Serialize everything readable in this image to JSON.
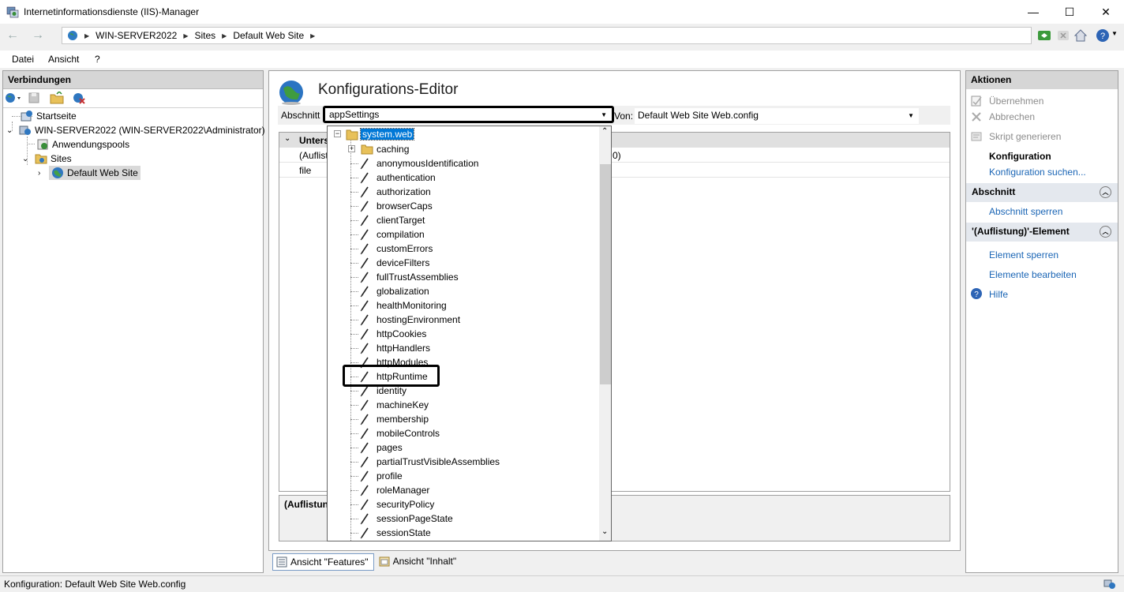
{
  "window": {
    "title": "Internetinformationsdienste (IIS)-Manager",
    "app_icon": "iis-manager-icon",
    "minimize": "—",
    "maximize": "☐",
    "close": "✕"
  },
  "address": {
    "crumbs": [
      "WIN-SERVER2022",
      "Sites",
      "Default Web Site"
    ]
  },
  "menu": [
    "Datei",
    "Ansicht",
    "?"
  ],
  "connections": {
    "header": "Verbindungen",
    "tree": [
      {
        "label": "Startseite",
        "icon": "start-page-icon"
      },
      {
        "label": "WIN-SERVER2022 (WIN-SERVER2022\\Administrator)",
        "icon": "server-icon",
        "expander": "v"
      },
      {
        "label": "Anwendungspools",
        "icon": "app-pools-icon"
      },
      {
        "label": "Sites",
        "icon": "sites-folder-icon",
        "expander": "v"
      },
      {
        "label": "Default Web Site",
        "icon": "globe-icon",
        "expander": ">",
        "selected": true
      }
    ]
  },
  "editor": {
    "title": "Konfigurations-Editor",
    "section_label": "Abschnitt",
    "section_value": "appSettings",
    "from_label": "Von:",
    "from_value": "Default Web Site Web.config",
    "group_label": "Unters",
    "row1_name": "(Auflist",
    "row1_value_suffix": "0)",
    "row2_name": "file",
    "desc_label": "(Auflistung"
  },
  "dropdown": {
    "root": "system.web",
    "items": [
      {
        "label": "caching",
        "type": "folder"
      },
      {
        "label": "anonymousIdentification",
        "type": "section"
      },
      {
        "label": "authentication",
        "type": "section"
      },
      {
        "label": "authorization",
        "type": "section"
      },
      {
        "label": "browserCaps",
        "type": "section"
      },
      {
        "label": "clientTarget",
        "type": "section"
      },
      {
        "label": "compilation",
        "type": "section"
      },
      {
        "label": "customErrors",
        "type": "section"
      },
      {
        "label": "deviceFilters",
        "type": "section"
      },
      {
        "label": "fullTrustAssemblies",
        "type": "section"
      },
      {
        "label": "globalization",
        "type": "section"
      },
      {
        "label": "healthMonitoring",
        "type": "section"
      },
      {
        "label": "hostingEnvironment",
        "type": "section"
      },
      {
        "label": "httpCookies",
        "type": "section"
      },
      {
        "label": "httpHandlers",
        "type": "section"
      },
      {
        "label": "httpModules",
        "type": "section"
      },
      {
        "label": "httpRuntime",
        "type": "section",
        "highlighted": true
      },
      {
        "label": "identity",
        "type": "section"
      },
      {
        "label": "machineKey",
        "type": "section"
      },
      {
        "label": "membership",
        "type": "section"
      },
      {
        "label": "mobileControls",
        "type": "section"
      },
      {
        "label": "pages",
        "type": "section"
      },
      {
        "label": "partialTrustVisibleAssemblies",
        "type": "section"
      },
      {
        "label": "profile",
        "type": "section"
      },
      {
        "label": "roleManager",
        "type": "section"
      },
      {
        "label": "securityPolicy",
        "type": "section"
      },
      {
        "label": "sessionPageState",
        "type": "section"
      },
      {
        "label": "sessionState",
        "type": "section"
      }
    ]
  },
  "view_tabs": [
    "Ansicht \"Features\"",
    "Ansicht \"Inhalt\""
  ],
  "actions": {
    "header": "Aktionen",
    "apply": "Übernehmen",
    "cancel": "Abbrechen",
    "generate_script": "Skript generieren",
    "config_heading": "Konfiguration",
    "config_search": "Konfiguration suchen...",
    "section_group": "Abschnitt",
    "lock_section": "Abschnitt sperren",
    "element_group": "'(Auflistung)'-Element",
    "lock_element": "Element sperren",
    "edit_elements": "Elemente bearbeiten",
    "help": "Hilfe"
  },
  "status": {
    "text": "Konfiguration: Default Web Site Web.config"
  }
}
